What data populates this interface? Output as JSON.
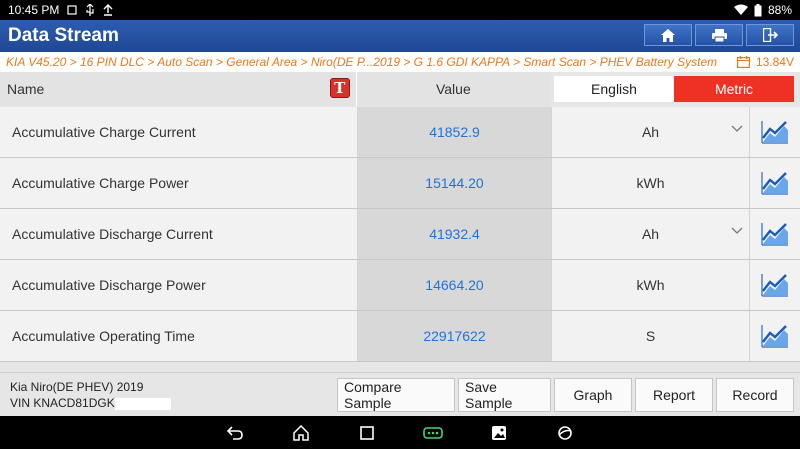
{
  "status": {
    "time": "10:45 PM",
    "battery": "88%"
  },
  "title": "Data Stream",
  "breadcrumb": {
    "path": "KIA V45.20 > 16 PIN DLC > Auto Scan > General Area > Niro(DE P...2019 > G 1.6 GDI KAPPA > Smart Scan > PHEV Battery System",
    "voltage": "13.84V"
  },
  "header": {
    "name": "Name",
    "value": "Value",
    "english": "English",
    "metric": "Metric",
    "t_icon": "T"
  },
  "rows": [
    {
      "name": "Accumulative Charge Current",
      "value": "41852.9",
      "unit": "Ah"
    },
    {
      "name": "Accumulative Charge Power",
      "value": "15144.20",
      "unit": "kWh"
    },
    {
      "name": "Accumulative Discharge Current",
      "value": "41932.4",
      "unit": "Ah"
    },
    {
      "name": "Accumulative Discharge Power",
      "value": "14664.20",
      "unit": "kWh"
    },
    {
      "name": "Accumulative Operating Time",
      "value": "22917622",
      "unit": "S"
    }
  ],
  "vehicle": {
    "model": "Kia Niro(DE PHEV) 2019",
    "vin": "VIN KNACD81DGK"
  },
  "actions": {
    "compare": "Compare Sample",
    "save": "Save Sample",
    "graph": "Graph",
    "report": "Report",
    "record": "Record"
  },
  "colors": {
    "accent": "#1f4795",
    "metric_active": "#ee3124",
    "value_text": "#1e73d8",
    "breadcrumb": "#e87a1e"
  },
  "icons": [
    "home-icon",
    "print-icon",
    "exit-icon",
    "graph-trend-icon",
    "calendar-icon",
    "chevron-down-icon",
    "back-icon",
    "home-nav-icon",
    "recents-icon",
    "vci-icon",
    "screenshot-icon",
    "browser-icon"
  ]
}
